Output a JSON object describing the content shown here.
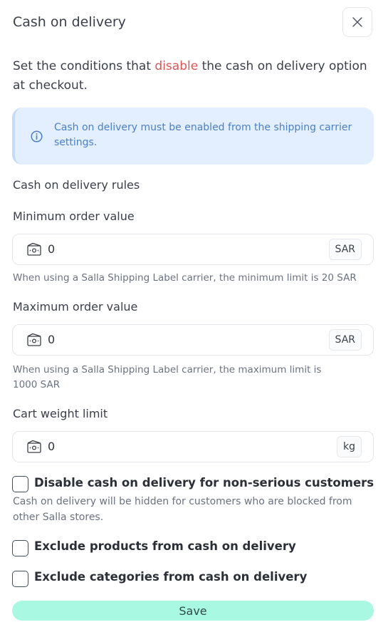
{
  "header": {
    "title": "Cash on delivery"
  },
  "intro": {
    "before": "Set the conditions that ",
    "highlight": "disable",
    "after": " the cash on delivery option at checkout."
  },
  "info": {
    "text": "Cash on delivery must be enabled from the shipping carrier settings."
  },
  "rules": {
    "section_title": "Cash on delivery rules",
    "min_order": {
      "label": "Minimum order value",
      "value": "0",
      "unit": "SAR",
      "help": "When using a Salla Shipping Label carrier, the minimum limit is 20 SAR"
    },
    "max_order": {
      "label": "Maximum order value",
      "value": "0",
      "unit": "SAR",
      "help": "When using a Salla Shipping Label carrier, the maximum limit is 1000 SAR"
    },
    "weight": {
      "label": "Cart weight limit",
      "value": "0",
      "unit": "kg"
    }
  },
  "options": {
    "non_serious": {
      "label": "Disable cash on delivery for non-serious customers",
      "description": "Cash on delivery will be hidden for customers who are blocked from other Salla stores.",
      "checked": false
    },
    "exclude_products": {
      "label": "Exclude products from cash on delivery",
      "checked": false
    },
    "exclude_categories": {
      "label": "Exclude categories from cash on delivery",
      "checked": false
    }
  },
  "footer": {
    "save_label": "Save"
  },
  "colors": {
    "accent": "#a8f8e2",
    "highlight": "#e05454",
    "info_bg": "#e3efff",
    "info_text": "#4b7fc9"
  },
  "icons": {
    "close": "close-icon",
    "info": "info-icon",
    "money": "money-icon"
  }
}
